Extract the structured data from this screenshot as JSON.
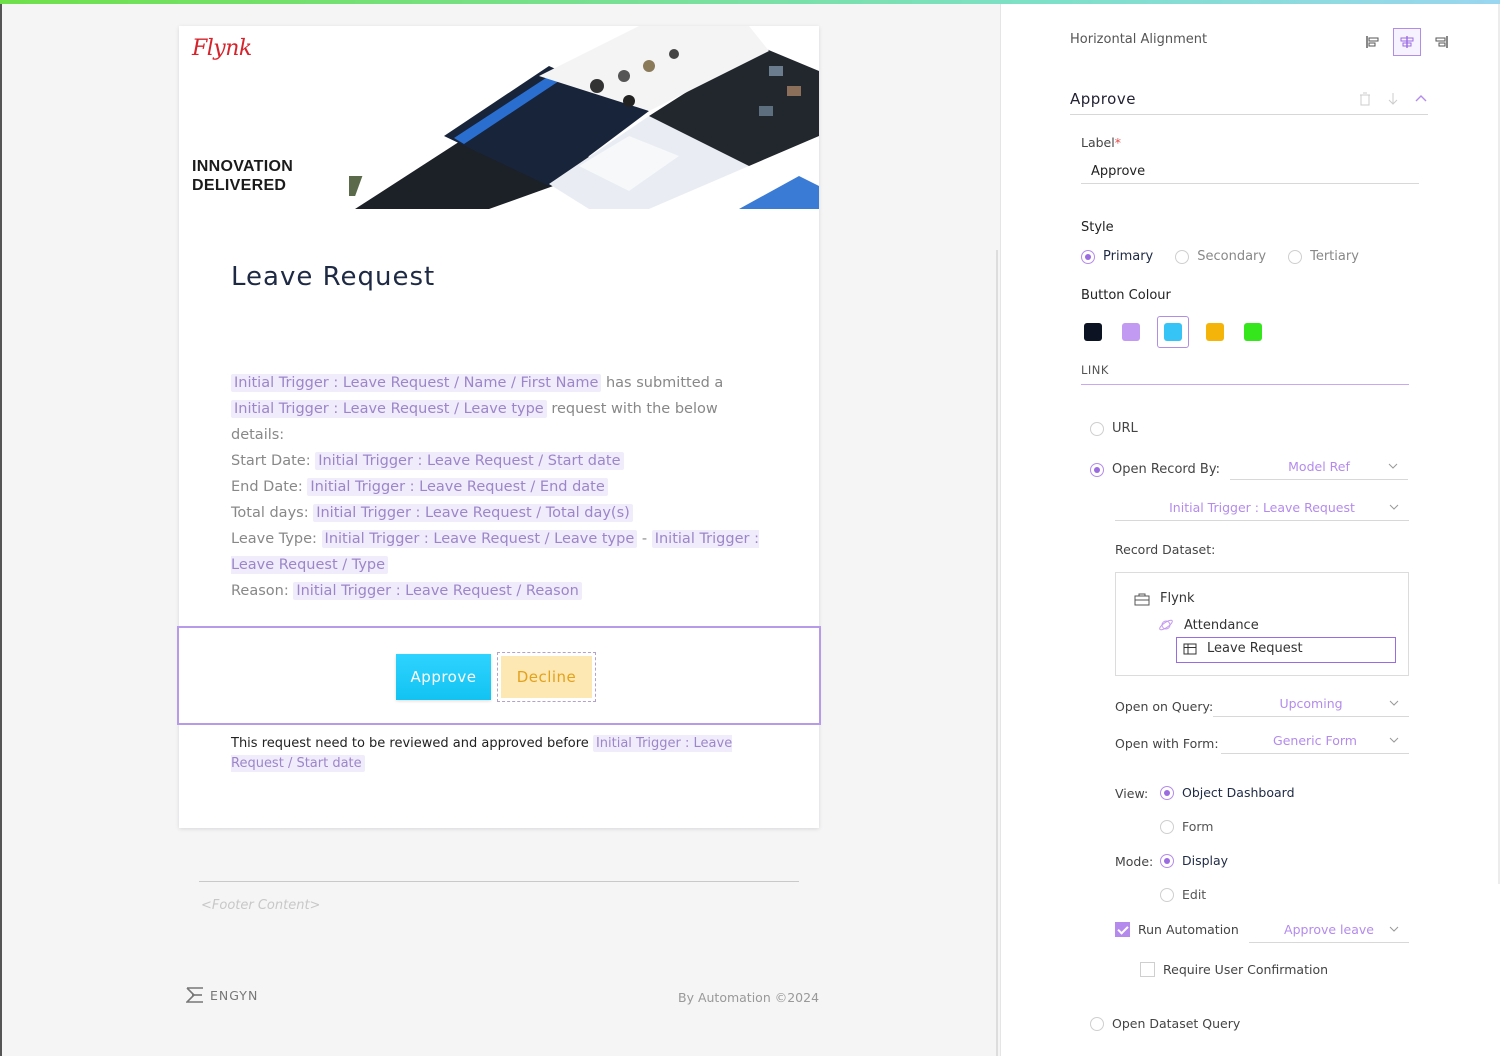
{
  "email": {
    "logo": "Flynk",
    "tagline": [
      "INNOVATION",
      "DELIVERED"
    ],
    "title": "Leave Request",
    "body": {
      "name_token": "Initial Trigger : Leave Request / Name / First Name",
      "submitted_text": " has submitted a",
      "leave_type_token": "Initial Trigger : Leave Request / Leave type",
      "request_text": " request with the below details:",
      "start_label": "Start Date: ",
      "start_token": "Initial Trigger : Leave Request / Start date",
      "end_label": "End Date: ",
      "end_token": "Initial Trigger : Leave Request / End date",
      "total_label": "Total days: ",
      "total_token": "Initial Trigger : Leave Request / Total day(s)",
      "type_label": "Leave Type: ",
      "type_token": "Initial Trigger : Leave Request / Leave type",
      "type_sep": " - ",
      "type_token2": "Initial Trigger : Leave Request / Type",
      "reason_label": "Reason: ",
      "reason_token": "Initial Trigger : Leave Request / Reason"
    },
    "approve_label": "Approve",
    "decline_label": "Decline",
    "note_text": "This request need to be reviewed and approved before ",
    "note_token": "Initial Trigger : Leave Request / Start date",
    "footer_content": "<Footer Content>",
    "brand": "ENGYN",
    "by_automation": "By Automation ©2024"
  },
  "panel": {
    "horizontal_alignment": "Horizontal Alignment",
    "alignment_selected": "center",
    "section_title": "Approve",
    "label_caption": "Label",
    "required_mark": "*",
    "label_value": "Approve",
    "style_caption": "Style",
    "styles": [
      {
        "label": "Primary",
        "selected": true
      },
      {
        "label": "Secondary",
        "selected": false
      },
      {
        "label": "Tertiary",
        "selected": false
      }
    ],
    "button_colour_caption": "Button Colour",
    "colours": [
      "#0c1323",
      "#c39af2",
      "#35c4f5",
      "#f5b40a",
      "#35e61c"
    ],
    "selected_colour": "#35c4f5",
    "link_caption": "LINK",
    "url_label": "URL",
    "open_record_label": "Open Record By:",
    "open_record_value": "Model Ref",
    "model_ref_value": "Initial Trigger : Leave Request",
    "record_dataset_label": "Record Dataset:",
    "tree": {
      "root": "Flynk",
      "child": "Attendance",
      "leaf": "Leave Request"
    },
    "open_on_query_label": "Open on Query:",
    "open_on_query_value": "Upcoming",
    "open_with_form_label": "Open with Form:",
    "open_with_form_value": "Generic Form",
    "view_label": "View:",
    "view_options": [
      {
        "label": "Object Dashboard",
        "selected": true
      },
      {
        "label": "Form",
        "selected": false
      }
    ],
    "mode_label": "Mode:",
    "mode_options": [
      {
        "label": "Display",
        "selected": true
      },
      {
        "label": "Edit",
        "selected": false
      }
    ],
    "run_automation_label": "Run Automation",
    "run_automation_checked": true,
    "run_automation_value": "Approve leave",
    "require_confirmation_label": "Require User Confirmation",
    "require_confirmation_checked": false,
    "open_dataset_query_label": "Open Dataset Query"
  }
}
